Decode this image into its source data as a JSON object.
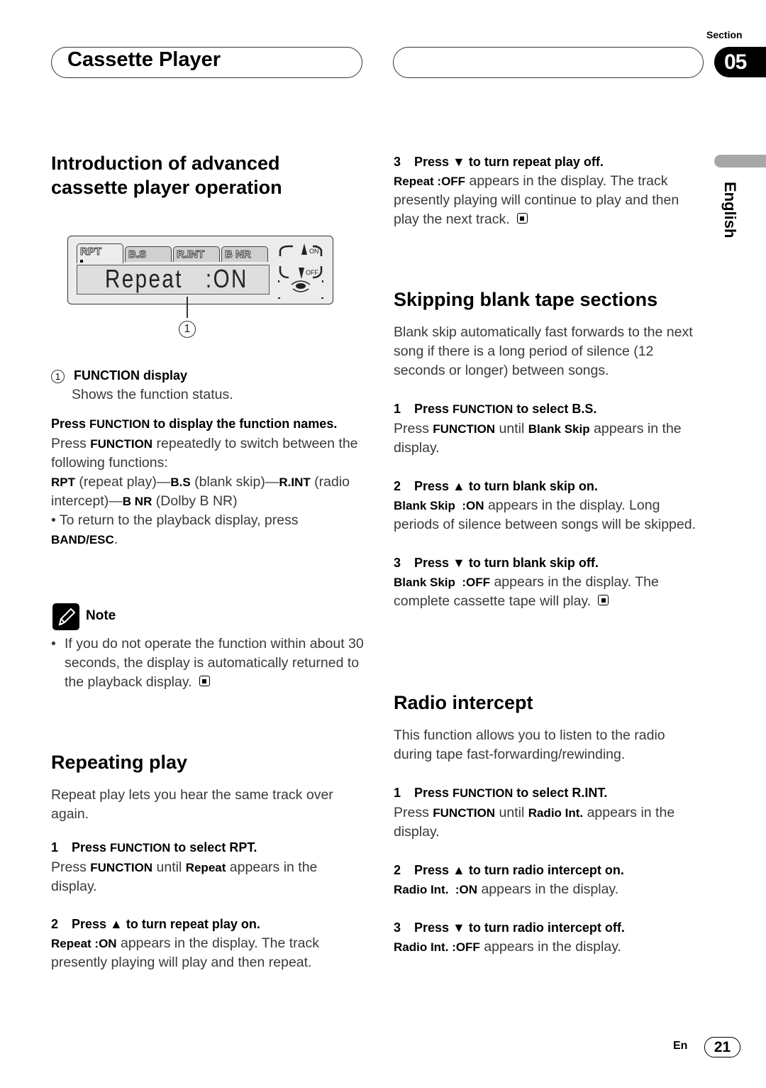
{
  "header": {
    "chapter_title": "Cassette Player",
    "section_label": "Section",
    "section_number": "05",
    "language_tab": "English"
  },
  "intro": {
    "heading_line1": "Introduction of advanced",
    "heading_line2": "cassette player operation",
    "display": {
      "tabs": [
        "RPT",
        "B.S",
        "R.INT",
        "B NR"
      ],
      "active_tab": "RPT",
      "screen_text": "Repeat   :ON",
      "up_label": "ON",
      "down_label": "OFF",
      "callout": "1"
    },
    "legend_num": "1",
    "legend_title": "FUNCTION display",
    "legend_desc": "Shows the function status.",
    "instr_heading_a": "Press ",
    "instr_heading_b": "FUNCTION",
    "instr_heading_c": " to display the function names.",
    "instr_p1_a": "Press ",
    "instr_p1_b": "FUNCTION",
    "instr_p1_c": " repeatedly to switch between the following functions:",
    "func_rpt": "RPT",
    "func_rpt_desc": " (repeat play)—",
    "func_bs": "B.S",
    "func_bs_desc": " (blank skip)—",
    "func_rint": "R.INT",
    "func_rint_desc": " (radio intercept)—",
    "func_bnr": "B NR",
    "func_bnr_desc": " (Dolby B NR)",
    "bullet_a": "• To return to the playback display, press ",
    "bullet_b": "BAND/ESC",
    "bullet_c": "."
  },
  "note": {
    "label": "Note",
    "text": "If you do not operate the function within about 30 seconds, the display is automatically returned to the playback display."
  },
  "repeating": {
    "heading": "Repeating play",
    "intro": "Repeat play lets you hear the same track over again.",
    "steps": [
      {
        "num": "1",
        "title_a": "Press ",
        "title_b": "FUNCTION",
        "title_c": " to select ",
        "title_d": "RPT.",
        "body_a": "Press ",
        "body_b": "FUNCTION",
        "body_c": " until ",
        "body_d": "Repeat",
        "body_e": " appears in the display."
      },
      {
        "num": "2",
        "title": "Press ▲ to turn repeat play on.",
        "body_b": "Repeat :ON",
        "body_c": " appears in the display. The track presently playing will play and then repeat."
      },
      {
        "num": "3",
        "title": "Press ▼ to turn repeat play off.",
        "body_b": "Repeat :OFF",
        "body_c": " appears in the display. The track presently playing will continue to play and then play the next track."
      }
    ]
  },
  "blank_skip": {
    "heading": "Skipping blank tape sections",
    "intro": "Blank skip automatically fast forwards to the next song if there is a long period of silence (12 seconds or longer) between songs.",
    "steps": [
      {
        "num": "1",
        "title_a": "Press ",
        "title_b": "FUNCTION",
        "title_c": " to select ",
        "title_d": "B.S.",
        "body_a": "Press ",
        "body_b": "FUNCTION",
        "body_c": " until ",
        "body_d": "Blank Skip",
        "body_e": " appears in the display."
      },
      {
        "num": "2",
        "title": "Press ▲ to turn blank skip on.",
        "body_b": "Blank Skip  :ON",
        "body_c": " appears in the display. Long periods of silence between songs will be skipped."
      },
      {
        "num": "3",
        "title": "Press ▼ to turn blank skip off.",
        "body_b": "Blank Skip  :OFF",
        "body_c": " appears in the display. The complete cassette tape will play."
      }
    ]
  },
  "radio_intercept": {
    "heading": "Radio intercept",
    "intro": "This function allows you to listen to the radio during tape fast-forwarding/rewinding.",
    "steps": [
      {
        "num": "1",
        "title_a": "Press ",
        "title_b": "FUNCTION",
        "title_c": " to select ",
        "title_d": "R.INT.",
        "body_a": "Press ",
        "body_b": "FUNCTION",
        "body_c": " until ",
        "body_d": "Radio Int.",
        "body_e": " appears in the display."
      },
      {
        "num": "2",
        "title": "Press ▲ to turn radio intercept on.",
        "body_b": "Radio Int.  :ON",
        "body_c": " appears in the display."
      },
      {
        "num": "3",
        "title": "Press ▼ to turn radio intercept off.",
        "body_b": "Radio Int. :OFF",
        "body_c": " appears in the display."
      }
    ]
  },
  "footer": {
    "lang": "En",
    "page": "21"
  }
}
